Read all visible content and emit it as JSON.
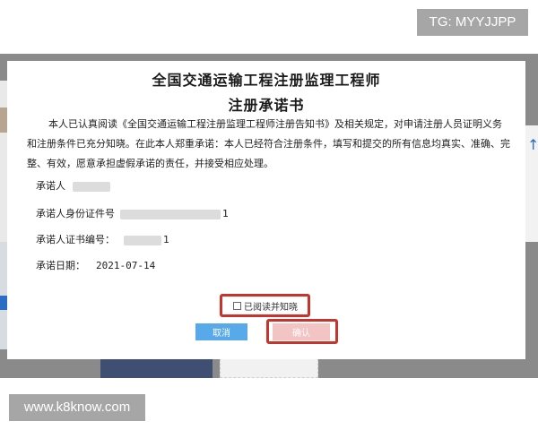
{
  "watermarks": {
    "top_right": "TG: MYYJJPP",
    "bottom_left": "www.k8know.com"
  },
  "dialog": {
    "title_line1": "全国交通运输工程注册监理工程师",
    "title_line2": "注册承诺书",
    "intro": "本人已认真阅读《全国交通运输工程注册监理工程师注册告知书》及相关规定，对申请注册人员证明义务和注册条件已充分知晓。在此本人郑重承诺：本人已经符合注册条件，填写和提交的所有信息均真实、准确、完整、有效，愿意承担虚假承诺的责任，并接受相应处理。",
    "fields": {
      "promiser_label": "承诺人",
      "id_label": "承诺人身份证件号",
      "id_suffix": "1",
      "cert_label": "承诺人证书编号：",
      "cert_suffix": "1",
      "date_label": "承诺日期：",
      "date_value": "2021-07-14"
    },
    "agree_checkbox_label": "已阅读并知晓",
    "cancel_label": "取消",
    "confirm_label": "确认"
  },
  "colors": {
    "highlight_red": "#c8332b",
    "cancel_blue": "#58a9ea",
    "confirm_disabled": "#f3c4c4"
  }
}
